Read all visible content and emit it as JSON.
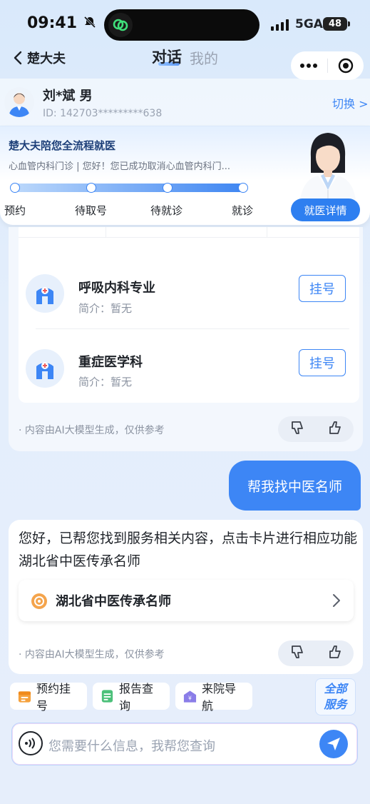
{
  "status_bar": {
    "time": "09:41",
    "network": "5GA",
    "battery": "48"
  },
  "nav": {
    "back_label": "楚大夫",
    "tab_active": "对话",
    "tab_other": "我的"
  },
  "patient": {
    "name": "刘*斌 男",
    "id": "ID: 142703*********638",
    "switch_label": "切换 >"
  },
  "journey": {
    "title": "楚大夫陪您全流程就医",
    "description": "心血管内科门诊 | 您好！您已成功取消心血管内科门...",
    "steps": [
      "预约",
      "待取号",
      "待就诊",
      "就诊"
    ],
    "detail_button": "就医详情"
  },
  "departments": [
    {
      "name": "呼吸内科专业",
      "intro": "简介：暂无",
      "button": "挂号"
    },
    {
      "name": "重症医学科",
      "intro": "简介：暂无",
      "button": "挂号"
    }
  ],
  "disclaimer": "· 内容由AI大模型生成，仅供参考",
  "user_message": "帮我找中医名师",
  "answer": {
    "text": "您好，已帮您找到服务相关内容，点击卡片进行相应功能湖北省中医传承名师",
    "link_title": "湖北省中医传承名师"
  },
  "quick_actions": [
    "预约挂号",
    "报告查询",
    "来院导航"
  ],
  "all_services": {
    "line1": "全部",
    "line2": "服务"
  },
  "input": {
    "placeholder": "您需要什么信息，我帮您查询"
  },
  "colors": {
    "primary": "#3d86f5",
    "background": "#e3edfb"
  }
}
